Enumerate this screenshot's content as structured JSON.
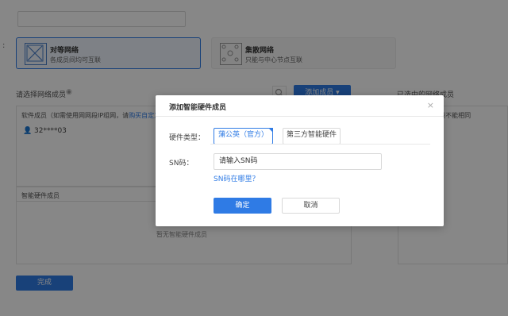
{
  "page": {
    "mode_colon": ":",
    "peer_mode": {
      "title": "对等网络",
      "desc": "各成员间均可互联"
    },
    "hub_mode": {
      "title": "集散网络",
      "desc": "只能与中心节点互联"
    },
    "select_members_label": "请选择网络成员",
    "add_member_button": "添加成员",
    "selected_members_label": "已选中的网络成员",
    "software_panel": {
      "header_prefix": "软件成员（如需使用网网段IP组网，请",
      "header_link": "购买自定义虚",
      "member": "32****03"
    },
    "right_panel_header": "组网成员IP网段不能相同",
    "hardware_panel": {
      "header": "智能硬件成员",
      "empty": "暂无智能硬件成员"
    },
    "finish_button": "完成"
  },
  "modal": {
    "title": "添加智能硬件成员",
    "close_glyph": "×",
    "hw_type_label": "硬件类型：",
    "tabs": [
      {
        "label": "蒲公英（官方）"
      },
      {
        "label": "第三方智能硬件"
      }
    ],
    "sn_label": "SN码：",
    "sn_value": "请输入SN码",
    "sn_help_link": "SN码在哪里？",
    "ok_button": "确定",
    "cancel_button": "取消"
  },
  "colors": {
    "accent": "#2f7be5",
    "overlay": "rgba(0,0,0,0.47)"
  }
}
